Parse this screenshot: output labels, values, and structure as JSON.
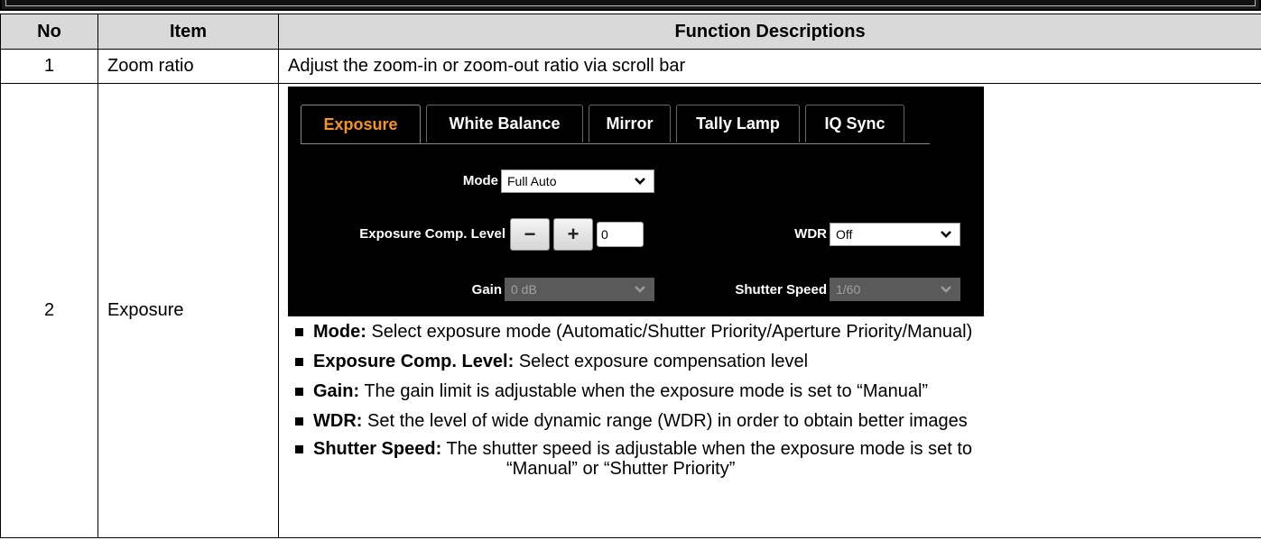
{
  "table": {
    "headers": {
      "no": "No",
      "item": "Item",
      "desc": "Function Descriptions"
    },
    "rows": [
      {
        "no": "1",
        "item": "Zoom ratio",
        "desc": "Adjust the zoom-in or zoom-out ratio via scroll bar"
      },
      {
        "no": "2",
        "item": "Exposure"
      }
    ]
  },
  "panel": {
    "tabs": [
      "Exposure",
      "White Balance",
      "Mirror",
      "Tally Lamp",
      "IQ Sync"
    ],
    "active_tab": "Exposure",
    "accent_color": "#f7941d",
    "mode_label": "Mode",
    "mode_value": "Full Auto",
    "exp_comp_label": "Exposure Comp. Level",
    "minus_label": "−",
    "plus_label": "+",
    "exp_comp_value": "0",
    "wdr_label": "WDR",
    "wdr_value": "Off",
    "gain_label": "Gain",
    "gain_value": "0 dB",
    "shutter_label": "Shutter Speed",
    "shutter_value": "1/60"
  },
  "bullets": [
    {
      "term": "Mode:",
      "text": " Select exposure mode (Automatic/Shutter Priority/Aperture Priority/Manual)"
    },
    {
      "term": "Exposure Comp. Level:",
      "text": " Select exposure compensation level"
    },
    {
      "term": "Gain:",
      "text": " The gain limit is adjustable when the exposure mode is set to “Manual”"
    },
    {
      "term": "WDR:",
      "text": " Set the level of wide dynamic range (WDR) in order to obtain better images"
    },
    {
      "term": "Shutter Speed:",
      "text": " The shutter speed is adjustable when the exposure mode is set to",
      "cont": "“Manual” or “Shutter Priority”"
    }
  ]
}
